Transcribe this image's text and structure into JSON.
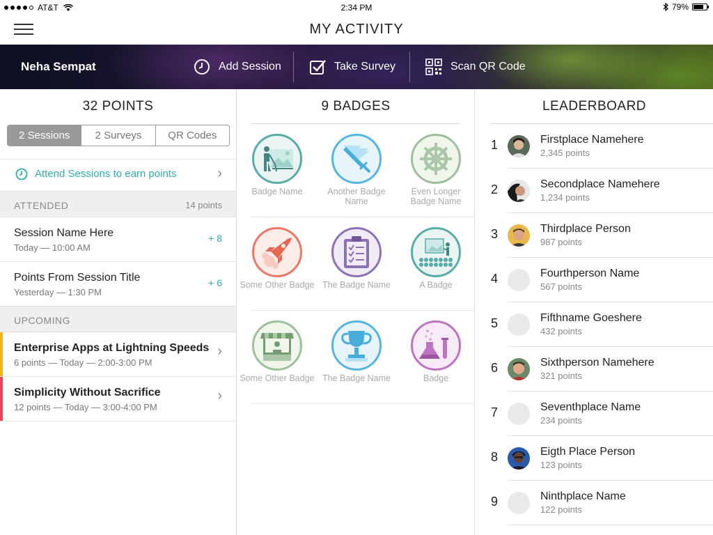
{
  "status_bar": {
    "carrier": "AT&T",
    "time": "2:34 PM",
    "battery": "79%",
    "battery_level": 0.79
  },
  "nav": {
    "title": "MY ACTIVITY"
  },
  "hero": {
    "user_name": "Neha Sempat",
    "actions": [
      {
        "label": "Add Session",
        "icon": "clock-icon"
      },
      {
        "label": "Take Survey",
        "icon": "checkbox-icon"
      },
      {
        "label": "Scan QR Code",
        "icon": "qr-code-icon"
      }
    ]
  },
  "points": {
    "heading": "32 POINTS",
    "segments": [
      "2 Sessions",
      "2 Surveys",
      "QR Codes"
    ],
    "active_segment": 0,
    "attend_prompt": "Attend Sessions to earn points",
    "attended": {
      "label": "ATTENDED",
      "points": "14 points",
      "items": [
        {
          "title": "Session Name Here",
          "sub": "Today — 10:00 AM",
          "plus": "+ 8"
        },
        {
          "title": "Points From Session Title",
          "sub": "Yesterday — 1:30 PM",
          "plus": "+ 6"
        }
      ]
    },
    "upcoming": {
      "label": "UPCOMING",
      "items": [
        {
          "title": "Enterprise Apps at Lightning Speeds",
          "sub": "6 points — Today — 2:00-3:00 PM",
          "color": "#f2b31b"
        },
        {
          "title": "Simplicity Without Sacrifice",
          "sub": "12 points — Today — 3:00-4:00 PM",
          "color": "#e8475a"
        }
      ]
    }
  },
  "badges": {
    "heading": "9 BADGES",
    "items": [
      {
        "name": "Badge Name",
        "icon": "hiker-icon",
        "color": "#3a9e9a",
        "bg": "#e6f3f1"
      },
      {
        "name": "Another Badge Name",
        "icon": "sword-icon",
        "color": "#3aa8d8",
        "bg": "#e3f4fb"
      },
      {
        "name": "Even Longer Badge Name",
        "icon": "ship-wheel-icon",
        "color": "#8cb58a",
        "bg": "#eef5e8"
      },
      {
        "name": "Some Other Badge",
        "icon": "rocket-icon",
        "color": "#e8604a",
        "bg": "#fbe9e5"
      },
      {
        "name": "The Badge Name",
        "icon": "clipboard-icon",
        "color": "#7a58a8",
        "bg": "#efe8f6"
      },
      {
        "name": "A Badge",
        "icon": "presentation-icon",
        "color": "#3a9e9a",
        "bg": "#e6f3f1"
      },
      {
        "name": "Some Other Badge",
        "icon": "market-stall-icon",
        "color": "#8cb58a",
        "bg": "#eef5e8"
      },
      {
        "name": "The Badge Name",
        "icon": "trophy-icon",
        "color": "#3aa8d8",
        "bg": "#e3f4fb"
      },
      {
        "name": "Badge",
        "icon": "flask-icon",
        "color": "#b25ab8",
        "bg": "#f6e8f6"
      }
    ]
  },
  "leaderboard": {
    "heading": "LEADERBOARD",
    "entries": [
      {
        "rank": "1",
        "name": "Firstplace Namehere",
        "points": "2,345 points",
        "avatar": "photo"
      },
      {
        "rank": "2",
        "name": "Secondplace Namehere",
        "points": "1,234 points",
        "avatar": "photo"
      },
      {
        "rank": "3",
        "name": "Thirdplace Person",
        "points": "987 points",
        "avatar": "photo"
      },
      {
        "rank": "4",
        "name": "Fourthperson Name",
        "points": "567 points",
        "avatar": "placeholder"
      },
      {
        "rank": "5",
        "name": "Fifthname Goeshere",
        "points": "432 points",
        "avatar": "placeholder"
      },
      {
        "rank": "6",
        "name": "Sixthperson Namehere",
        "points": "321 points",
        "avatar": "photo"
      },
      {
        "rank": "7",
        "name": "Seventhplace Name",
        "points": "234 points",
        "avatar": "placeholder"
      },
      {
        "rank": "8",
        "name": "Eigth Place Person",
        "points": "123 points",
        "avatar": "photo"
      },
      {
        "rank": "9",
        "name": "Ninthplace Name",
        "points": "122 points",
        "avatar": "placeholder"
      }
    ]
  }
}
